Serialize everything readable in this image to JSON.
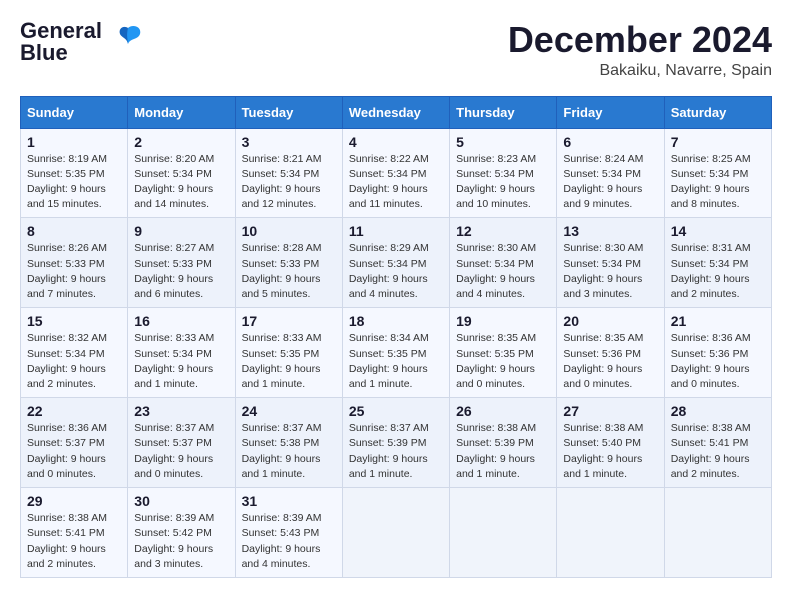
{
  "logo": {
    "line1": "General",
    "line2": "Blue"
  },
  "title": "December 2024",
  "location": "Bakaiku, Navarre, Spain",
  "weekdays": [
    "Sunday",
    "Monday",
    "Tuesday",
    "Wednesday",
    "Thursday",
    "Friday",
    "Saturday"
  ],
  "weeks": [
    [
      {
        "day": "1",
        "sunrise": "8:19 AM",
        "sunset": "5:35 PM",
        "daylight": "9 hours and 15 minutes."
      },
      {
        "day": "2",
        "sunrise": "8:20 AM",
        "sunset": "5:34 PM",
        "daylight": "9 hours and 14 minutes."
      },
      {
        "day": "3",
        "sunrise": "8:21 AM",
        "sunset": "5:34 PM",
        "daylight": "9 hours and 12 minutes."
      },
      {
        "day": "4",
        "sunrise": "8:22 AM",
        "sunset": "5:34 PM",
        "daylight": "9 hours and 11 minutes."
      },
      {
        "day": "5",
        "sunrise": "8:23 AM",
        "sunset": "5:34 PM",
        "daylight": "9 hours and 10 minutes."
      },
      {
        "day": "6",
        "sunrise": "8:24 AM",
        "sunset": "5:34 PM",
        "daylight": "9 hours and 9 minutes."
      },
      {
        "day": "7",
        "sunrise": "8:25 AM",
        "sunset": "5:34 PM",
        "daylight": "9 hours and 8 minutes."
      }
    ],
    [
      {
        "day": "8",
        "sunrise": "8:26 AM",
        "sunset": "5:33 PM",
        "daylight": "9 hours and 7 minutes."
      },
      {
        "day": "9",
        "sunrise": "8:27 AM",
        "sunset": "5:33 PM",
        "daylight": "9 hours and 6 minutes."
      },
      {
        "day": "10",
        "sunrise": "8:28 AM",
        "sunset": "5:33 PM",
        "daylight": "9 hours and 5 minutes."
      },
      {
        "day": "11",
        "sunrise": "8:29 AM",
        "sunset": "5:34 PM",
        "daylight": "9 hours and 4 minutes."
      },
      {
        "day": "12",
        "sunrise": "8:30 AM",
        "sunset": "5:34 PM",
        "daylight": "9 hours and 4 minutes."
      },
      {
        "day": "13",
        "sunrise": "8:30 AM",
        "sunset": "5:34 PM",
        "daylight": "9 hours and 3 minutes."
      },
      {
        "day": "14",
        "sunrise": "8:31 AM",
        "sunset": "5:34 PM",
        "daylight": "9 hours and 2 minutes."
      }
    ],
    [
      {
        "day": "15",
        "sunrise": "8:32 AM",
        "sunset": "5:34 PM",
        "daylight": "9 hours and 2 minutes."
      },
      {
        "day": "16",
        "sunrise": "8:33 AM",
        "sunset": "5:34 PM",
        "daylight": "9 hours and 1 minute."
      },
      {
        "day": "17",
        "sunrise": "8:33 AM",
        "sunset": "5:35 PM",
        "daylight": "9 hours and 1 minute."
      },
      {
        "day": "18",
        "sunrise": "8:34 AM",
        "sunset": "5:35 PM",
        "daylight": "9 hours and 1 minute."
      },
      {
        "day": "19",
        "sunrise": "8:35 AM",
        "sunset": "5:35 PM",
        "daylight": "9 hours and 0 minutes."
      },
      {
        "day": "20",
        "sunrise": "8:35 AM",
        "sunset": "5:36 PM",
        "daylight": "9 hours and 0 minutes."
      },
      {
        "day": "21",
        "sunrise": "8:36 AM",
        "sunset": "5:36 PM",
        "daylight": "9 hours and 0 minutes."
      }
    ],
    [
      {
        "day": "22",
        "sunrise": "8:36 AM",
        "sunset": "5:37 PM",
        "daylight": "9 hours and 0 minutes."
      },
      {
        "day": "23",
        "sunrise": "8:37 AM",
        "sunset": "5:37 PM",
        "daylight": "9 hours and 0 minutes."
      },
      {
        "day": "24",
        "sunrise": "8:37 AM",
        "sunset": "5:38 PM",
        "daylight": "9 hours and 1 minute."
      },
      {
        "day": "25",
        "sunrise": "8:37 AM",
        "sunset": "5:39 PM",
        "daylight": "9 hours and 1 minute."
      },
      {
        "day": "26",
        "sunrise": "8:38 AM",
        "sunset": "5:39 PM",
        "daylight": "9 hours and 1 minute."
      },
      {
        "day": "27",
        "sunrise": "8:38 AM",
        "sunset": "5:40 PM",
        "daylight": "9 hours and 1 minute."
      },
      {
        "day": "28",
        "sunrise": "8:38 AM",
        "sunset": "5:41 PM",
        "daylight": "9 hours and 2 minutes."
      }
    ],
    [
      {
        "day": "29",
        "sunrise": "8:38 AM",
        "sunset": "5:41 PM",
        "daylight": "9 hours and 2 minutes."
      },
      {
        "day": "30",
        "sunrise": "8:39 AM",
        "sunset": "5:42 PM",
        "daylight": "9 hours and 3 minutes."
      },
      {
        "day": "31",
        "sunrise": "8:39 AM",
        "sunset": "5:43 PM",
        "daylight": "9 hours and 4 minutes."
      },
      null,
      null,
      null,
      null
    ]
  ]
}
